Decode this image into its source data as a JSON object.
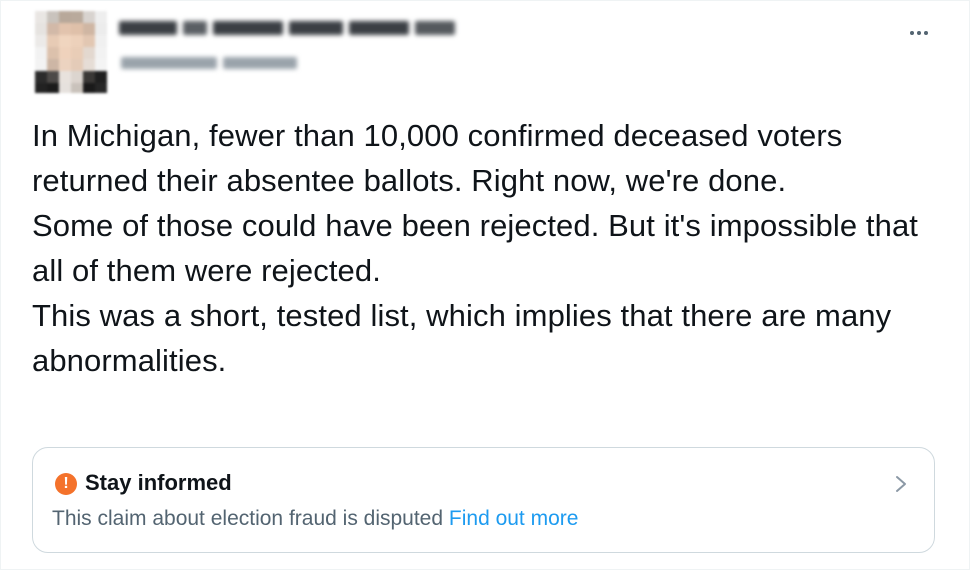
{
  "author": {
    "display_name": "",
    "handle": "",
    "avatar": "avatar-icon"
  },
  "menu": {
    "icon": "more-horizontal-icon"
  },
  "tweet": {
    "lines": [
      "In Michigan, fewer than 10,000 confirmed deceased voters returned their absentee ballots. Right now, we're done.",
      "Some of those could have been rejected. But it's impossible that all of them were rejected.",
      "This was a short, tested list, which implies that there are many abnormalities."
    ]
  },
  "notice": {
    "icon": "exclamation-circle-icon",
    "icon_glyph": "!",
    "title": "Stay informed",
    "body": "This claim about election fraud is disputed",
    "link": "Find out more",
    "chevron": "chevron-right-icon",
    "accent_color": "#f4722b",
    "link_color": "#1d9bf0"
  }
}
